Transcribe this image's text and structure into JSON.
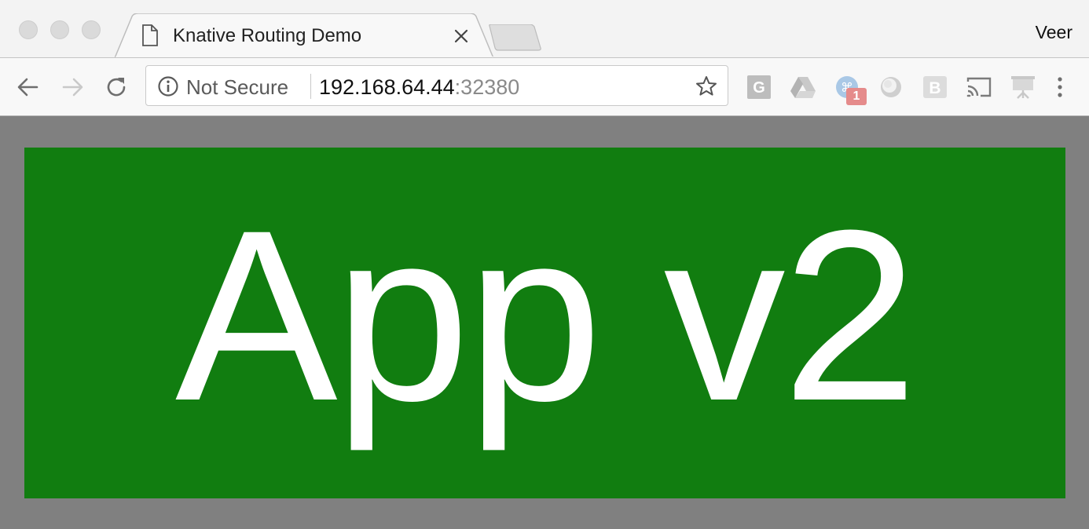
{
  "window": {
    "traffic_lights": [
      "close",
      "minimize",
      "zoom"
    ],
    "profile_name": "Veer"
  },
  "tab": {
    "title": "Knative Routing Demo",
    "icon": "page-icon",
    "close_icon": "close-icon"
  },
  "toolbar": {
    "back_icon": "back-arrow-icon",
    "forward_icon": "forward-arrow-icon",
    "reload_icon": "reload-icon",
    "security_label": "Not Secure",
    "url_host": "192.168.64.44",
    "url_port": ":32380",
    "bookmark_icon": "star-icon",
    "extensions": [
      {
        "name": "google-translate-extension-icon"
      },
      {
        "name": "google-drive-extension-icon"
      },
      {
        "name": "keyboard-shortcut-extension-icon",
        "badge": "1"
      },
      {
        "name": "circle-extension-icon"
      },
      {
        "name": "bootstrap-extension-icon"
      },
      {
        "name": "cast-icon"
      },
      {
        "name": "presentation-extension-icon"
      }
    ],
    "menu_icon": "kebab-menu-icon"
  },
  "page": {
    "heading": "App v2",
    "background_color": "#808080",
    "panel_color": "#117d10",
    "text_color": "#ffffff"
  }
}
